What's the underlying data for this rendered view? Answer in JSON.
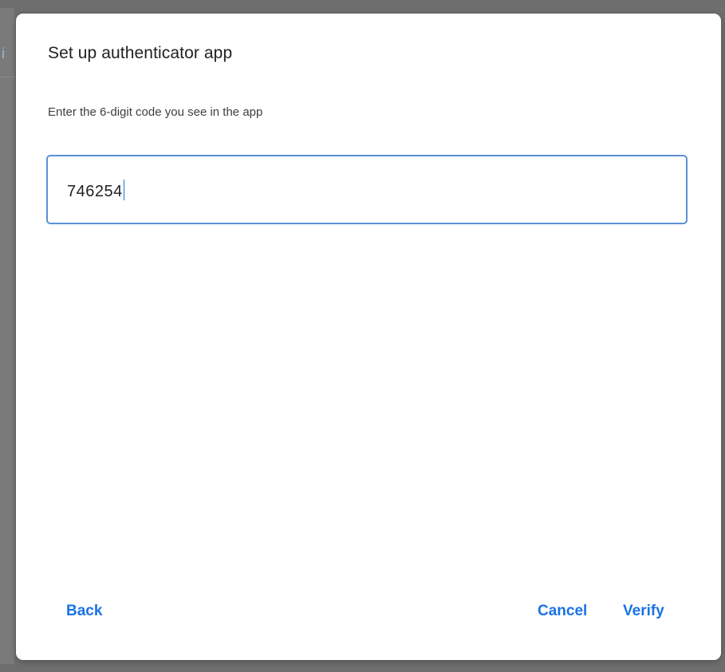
{
  "dialog": {
    "title": "Set up authenticator app",
    "instructions": "Enter the 6-digit code you see in the app"
  },
  "code_input": {
    "value": "746254",
    "focused": true
  },
  "actions": {
    "back_label": "Back",
    "cancel_label": "Cancel",
    "verify_label": "Verify"
  },
  "colors": {
    "accent": "#1a73e8",
    "focus_border": "#5b8fd6",
    "backdrop": "#6e6e6e"
  }
}
